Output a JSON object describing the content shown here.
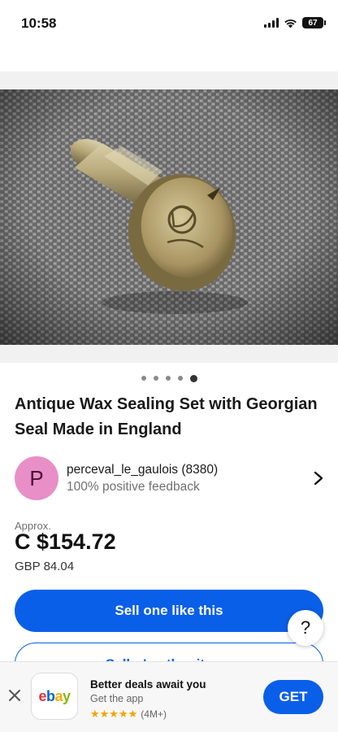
{
  "status_bar": {
    "time": "10:58",
    "battery": "67",
    "icons": [
      "signal-icon",
      "wifi-icon",
      "battery-icon"
    ]
  },
  "gallery": {
    "image_subject": "antique brass wax seal stamp on grey woven fabric",
    "dot_count": 5,
    "active_index": 4
  },
  "listing": {
    "title": "Antique Wax Sealing Set with Georgian Seal Made in England",
    "seller": {
      "avatar_letter": "P",
      "name": "perceval_le_gaulois (8380)",
      "feedback": "100% positive feedback"
    },
    "price": {
      "approx_label": "Approx.",
      "amount": "C $154.72",
      "original": "GBP 84.04"
    }
  },
  "actions": {
    "sell_label": "Sell one like this",
    "other_items_label": "Seller's other items",
    "help_label": "?"
  },
  "app_banner": {
    "title": "Better deals await you",
    "subtitle": "Get the app",
    "rating_count": "(4M+)",
    "stars": "★★★★★",
    "get_label": "GET",
    "logo": {
      "e": "e",
      "b": "b",
      "a": "a",
      "y": "y"
    }
  },
  "colors": {
    "accent": "#0a5fe8",
    "avatar_bg": "#e88fc7",
    "star": "#f5a300"
  }
}
